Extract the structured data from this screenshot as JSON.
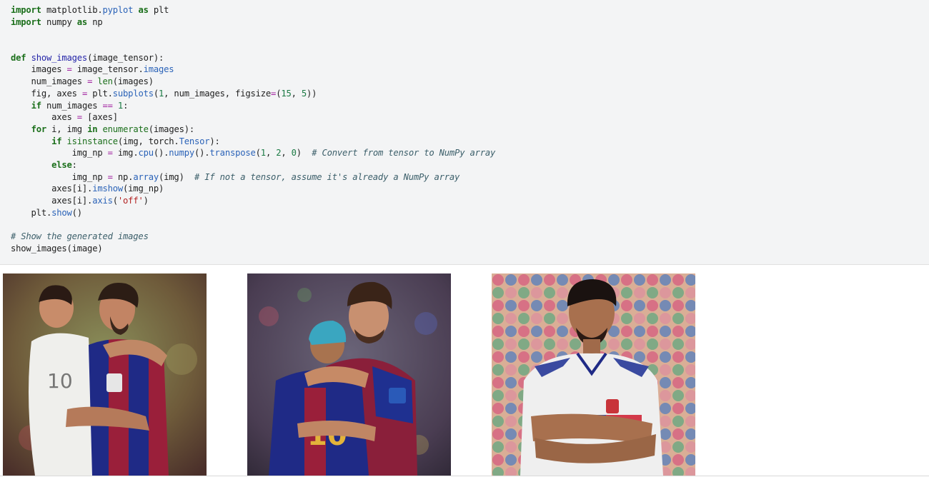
{
  "code_cell": {
    "lines": [
      [
        {
          "t": "import",
          "c": "kw"
        },
        {
          "t": " matplotlib.",
          "c": ""
        },
        {
          "t": "pyplot",
          "c": "attr"
        },
        {
          "t": " ",
          "c": ""
        },
        {
          "t": "as",
          "c": "kw"
        },
        {
          "t": " plt",
          "c": ""
        }
      ],
      [
        {
          "t": "import",
          "c": "kw"
        },
        {
          "t": " numpy ",
          "c": ""
        },
        {
          "t": "as",
          "c": "kw"
        },
        {
          "t": " np",
          "c": ""
        }
      ],
      [],
      [],
      [
        {
          "t": "def",
          "c": "kw"
        },
        {
          "t": " ",
          "c": ""
        },
        {
          "t": "show_images",
          "c": "fn"
        },
        {
          "t": "(image_tensor):",
          "c": ""
        }
      ],
      [
        {
          "t": "    images ",
          "c": ""
        },
        {
          "t": "=",
          "c": "op"
        },
        {
          "t": " image_tensor.",
          "c": ""
        },
        {
          "t": "images",
          "c": "attr"
        }
      ],
      [
        {
          "t": "    num_images ",
          "c": ""
        },
        {
          "t": "=",
          "c": "op"
        },
        {
          "t": " ",
          "c": ""
        },
        {
          "t": "len",
          "c": "bi"
        },
        {
          "t": "(images)",
          "c": ""
        }
      ],
      [
        {
          "t": "    fig, axes ",
          "c": ""
        },
        {
          "t": "=",
          "c": "op"
        },
        {
          "t": " plt.",
          "c": ""
        },
        {
          "t": "subplots",
          "c": "attr"
        },
        {
          "t": "(",
          "c": ""
        },
        {
          "t": "1",
          "c": "num"
        },
        {
          "t": ", num_images, figsize",
          "c": ""
        },
        {
          "t": "=",
          "c": "op"
        },
        {
          "t": "(",
          "c": ""
        },
        {
          "t": "15",
          "c": "num"
        },
        {
          "t": ", ",
          "c": ""
        },
        {
          "t": "5",
          "c": "num"
        },
        {
          "t": "))",
          "c": ""
        }
      ],
      [
        {
          "t": "    ",
          "c": ""
        },
        {
          "t": "if",
          "c": "kw"
        },
        {
          "t": " num_images ",
          "c": ""
        },
        {
          "t": "==",
          "c": "op"
        },
        {
          "t": " ",
          "c": ""
        },
        {
          "t": "1",
          "c": "num"
        },
        {
          "t": ":",
          "c": ""
        }
      ],
      [
        {
          "t": "        axes ",
          "c": ""
        },
        {
          "t": "=",
          "c": "op"
        },
        {
          "t": " [axes]",
          "c": ""
        }
      ],
      [
        {
          "t": "    ",
          "c": ""
        },
        {
          "t": "for",
          "c": "kw"
        },
        {
          "t": " i, img ",
          "c": ""
        },
        {
          "t": "in",
          "c": "kw"
        },
        {
          "t": " ",
          "c": ""
        },
        {
          "t": "enumerate",
          "c": "bi"
        },
        {
          "t": "(images):",
          "c": ""
        }
      ],
      [
        {
          "t": "        ",
          "c": ""
        },
        {
          "t": "if",
          "c": "kw"
        },
        {
          "t": " ",
          "c": ""
        },
        {
          "t": "isinstance",
          "c": "bi"
        },
        {
          "t": "(img, torch.",
          "c": ""
        },
        {
          "t": "Tensor",
          "c": "attr"
        },
        {
          "t": "):",
          "c": ""
        }
      ],
      [
        {
          "t": "            img_np ",
          "c": ""
        },
        {
          "t": "=",
          "c": "op"
        },
        {
          "t": " img.",
          "c": ""
        },
        {
          "t": "cpu",
          "c": "attr"
        },
        {
          "t": "().",
          "c": ""
        },
        {
          "t": "numpy",
          "c": "attr"
        },
        {
          "t": "().",
          "c": ""
        },
        {
          "t": "transpose",
          "c": "attr"
        },
        {
          "t": "(",
          "c": ""
        },
        {
          "t": "1",
          "c": "num"
        },
        {
          "t": ", ",
          "c": ""
        },
        {
          "t": "2",
          "c": "num"
        },
        {
          "t": ", ",
          "c": ""
        },
        {
          "t": "0",
          "c": "num"
        },
        {
          "t": ")  ",
          "c": ""
        },
        {
          "t": "# Convert from tensor to NumPy array",
          "c": "cm"
        }
      ],
      [
        {
          "t": "        ",
          "c": ""
        },
        {
          "t": "else",
          "c": "kw"
        },
        {
          "t": ":",
          "c": ""
        }
      ],
      [
        {
          "t": "            img_np ",
          "c": ""
        },
        {
          "t": "=",
          "c": "op"
        },
        {
          "t": " np.",
          "c": ""
        },
        {
          "t": "array",
          "c": "attr"
        },
        {
          "t": "(img)  ",
          "c": ""
        },
        {
          "t": "# If not a tensor, assume it's already a NumPy array",
          "c": "cm"
        }
      ],
      [
        {
          "t": "        axes[i].",
          "c": ""
        },
        {
          "t": "imshow",
          "c": "attr"
        },
        {
          "t": "(img_np)",
          "c": ""
        }
      ],
      [
        {
          "t": "        axes[i].",
          "c": ""
        },
        {
          "t": "axis",
          "c": "attr"
        },
        {
          "t": "(",
          "c": ""
        },
        {
          "t": "'off'",
          "c": "str"
        },
        {
          "t": ")",
          "c": ""
        }
      ],
      [
        {
          "t": "    plt.",
          "c": ""
        },
        {
          "t": "show",
          "c": "attr"
        },
        {
          "t": "()",
          "c": ""
        }
      ],
      [],
      [
        {
          "t": "# Show the generated images",
          "c": "cm"
        }
      ],
      [
        {
          "t": "show_images(image)",
          "c": ""
        }
      ]
    ]
  },
  "output": {
    "images": [
      {
        "description": "two men embracing, one in white jersey, one in blaugrana jersey"
      },
      {
        "description": "man in blaugrana jersey hugging a man in a cap, jersey number 10"
      },
      {
        "description": "man with arms crossed in white sports jersey on polka-dot background"
      }
    ]
  },
  "colors": {
    "keyword": "#1b6f1b",
    "function": "#2424a8",
    "attribute": "#2b63b8",
    "number": "#1b7a44",
    "string": "#b22222",
    "comment": "#3c5f6a",
    "operator": "#a020a0",
    "cell_background": "#f3f4f5"
  }
}
